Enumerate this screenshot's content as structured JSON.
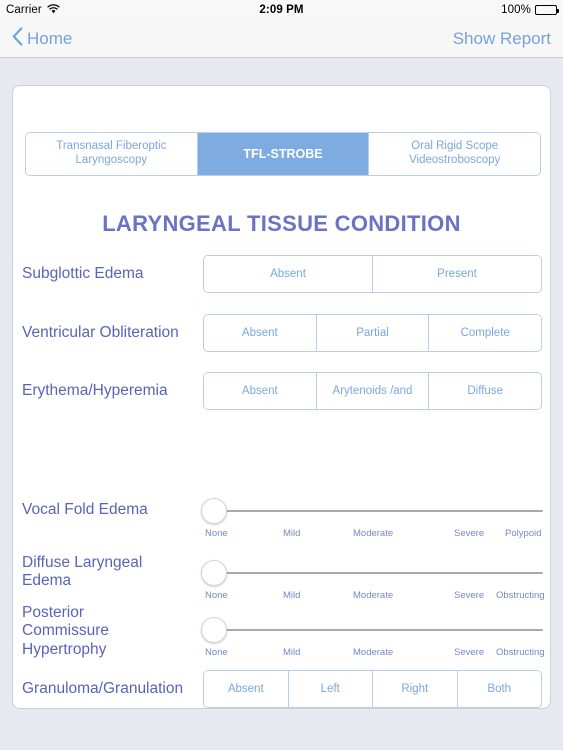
{
  "status_bar": {
    "carrier": "Carrier",
    "wifi_icon": "wifi-icon",
    "time": "2:09 PM",
    "battery_percent": "100%",
    "battery_icon": "battery-full-icon"
  },
  "nav_bar": {
    "back_icon": "chevron-left-icon",
    "back_label": "Home",
    "action_label": "Show Report"
  },
  "mode_segments": [
    {
      "label": "Transnasal Fiberoptic Laryngoscopy",
      "selected": false
    },
    {
      "label": "TFL-STROBE",
      "selected": true
    },
    {
      "label": "Oral Rigid Scope Videostroboscopy",
      "selected": false
    }
  ],
  "section_title": "LARYNGEAL TISSUE CONDITION",
  "option_rows": [
    {
      "label": "Subglottic Edema",
      "options": [
        {
          "label": "Absent",
          "selected": false
        },
        {
          "label": "Present",
          "selected": false
        }
      ]
    },
    {
      "label": "Ventricular Obliteration",
      "options": [
        {
          "label": "Absent",
          "selected": false
        },
        {
          "label": "Partial",
          "selected": false
        },
        {
          "label": "Complete",
          "selected": false
        }
      ]
    },
    {
      "label": "Erythema/Hyperemia",
      "options": [
        {
          "label": "Absent",
          "selected": false
        },
        {
          "label": "Arytenoids /and",
          "selected": false
        },
        {
          "label": "Diffuse",
          "selected": false
        }
      ]
    }
  ],
  "slider_rows": [
    {
      "label": "Vocal Fold Edema",
      "value": 0,
      "scale": [
        "None",
        "Mild",
        "Moderate",
        "Severe",
        "Polypoid"
      ]
    },
    {
      "label": "Diffuse Laryngeal Edema",
      "value": 0,
      "scale": [
        "None",
        "Mild",
        "Moderate",
        "Severe",
        "Obstructing"
      ]
    },
    {
      "label": "Posterior Commissure Hypertrophy",
      "value": 0,
      "scale": [
        "None",
        "Mild",
        "Moderate",
        "Severe",
        "Obstructing"
      ]
    }
  ],
  "granuloma_row": {
    "label": "Granuloma/Granulation",
    "options": [
      {
        "label": "Absent",
        "selected": false
      },
      {
        "label": "Left",
        "selected": false
      },
      {
        "label": "Right",
        "selected": false
      },
      {
        "label": "Both",
        "selected": false
      }
    ]
  },
  "colors": {
    "accent_blue": "#7eabe0",
    "label_purple": "#5b63b8",
    "title_purple": "#6a73c4",
    "background": "#e7e9f0"
  }
}
